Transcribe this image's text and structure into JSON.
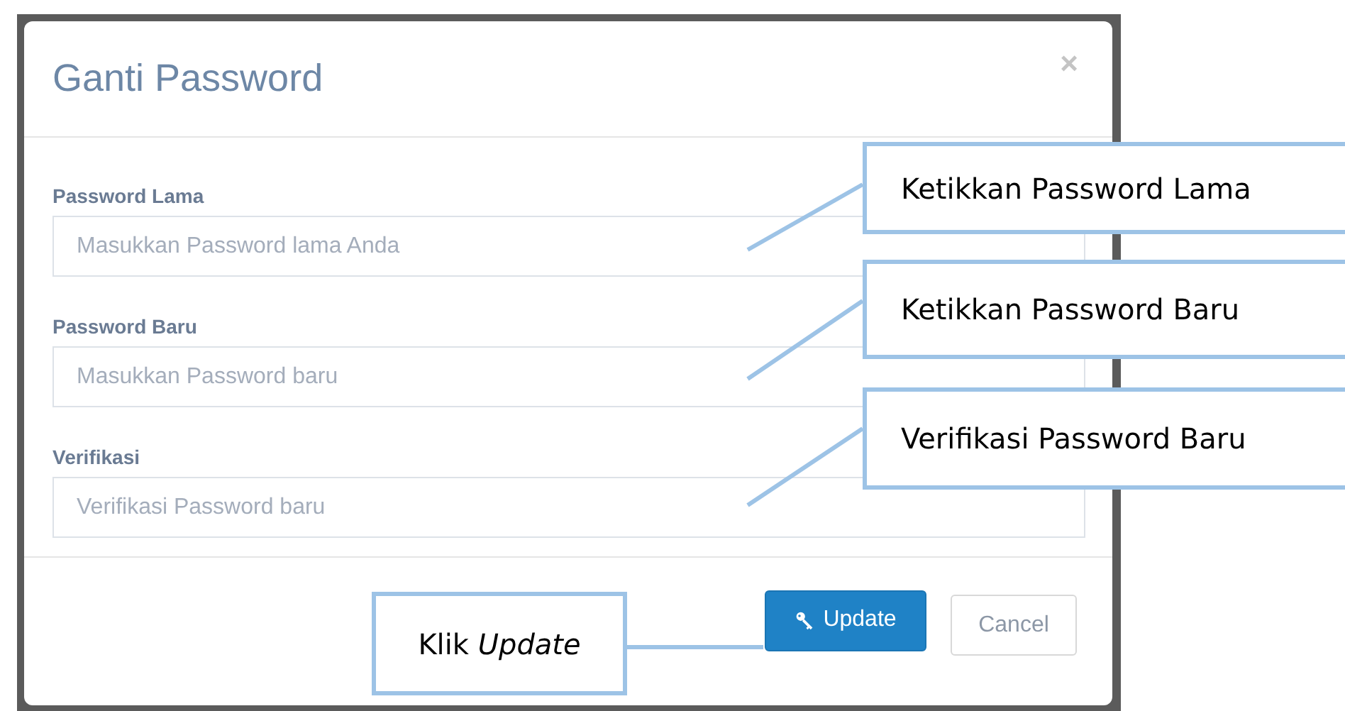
{
  "dialog": {
    "title": "Ganti Password",
    "close": "×",
    "fields": [
      {
        "label": "Password Lama",
        "placeholder": "Masukkan Password lama Anda"
      },
      {
        "label": "Password Baru",
        "placeholder": "Masukkan Password baru"
      },
      {
        "label": "Verifikasi",
        "placeholder": "Verifikasi Password baru"
      }
    ],
    "buttons": [
      {
        "label": "Update",
        "kind": "primary"
      },
      {
        "label": "Cancel",
        "kind": "default"
      }
    ]
  },
  "callouts": [
    "Ketikkan Password Lama",
    "Ketikkan Password Baru",
    "Verifikasi Password Baru",
    "Klik *Update*"
  ]
}
